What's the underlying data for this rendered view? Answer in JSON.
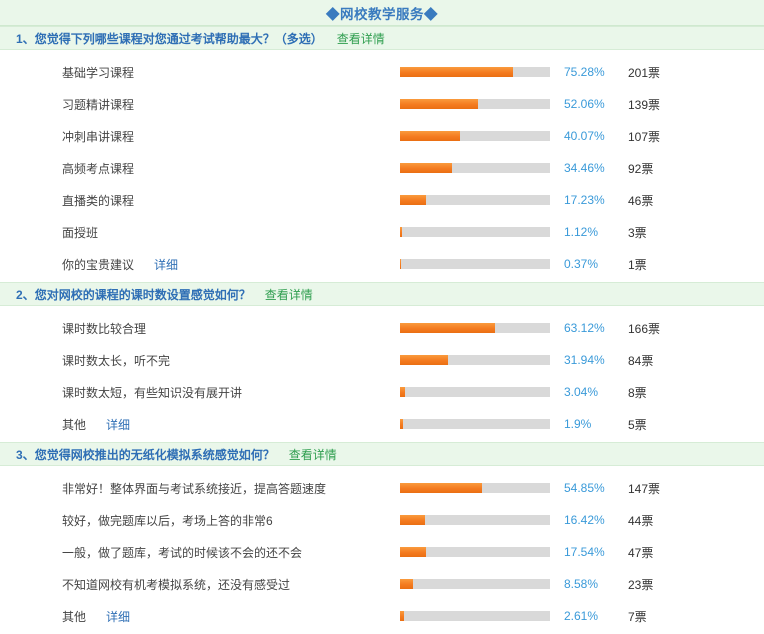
{
  "header": {
    "title": "◆网校教学服务◆",
    "accent_color": "#3a7bbf",
    "band_color": "#eaf7ea"
  },
  "labels": {
    "detail_link": "查看详情",
    "inline_detail": "详细",
    "vote_unit": "票"
  },
  "chart_data": [
    {
      "type": "bar",
      "orientation": "horizontal",
      "title": "1、您觉得下列哪些课程对您通过考试帮助最大？（多选）",
      "number": "1、",
      "question": "您觉得下列哪些课程对您通过考试帮助最大？（多选）",
      "link": "查看详情",
      "xlabel": "",
      "ylabel": "",
      "xlim": [
        0,
        100
      ],
      "unit": "%",
      "grid": false,
      "bar_color": "#f47b20",
      "track_color": "#d9d9d9",
      "categories": [
        "基础学习课程",
        "习题精讲课程",
        "冲刺串讲课程",
        "高频考点课程",
        "直播类的课程",
        "面授班",
        "你的宝贵建议"
      ],
      "values": [
        75.28,
        52.06,
        40.07,
        34.46,
        17.23,
        1.12,
        0.37
      ],
      "pct_labels": [
        "75.28%",
        "52.06%",
        "40.07%",
        "34.46%",
        "17.23%",
        "1.12%",
        "0.37%"
      ],
      "counts": [
        201,
        139,
        107,
        92,
        46,
        3,
        1
      ],
      "count_labels": [
        "201票",
        "139票",
        "107票",
        "92票",
        "46票",
        "3票",
        "1票"
      ],
      "extras": [
        null,
        null,
        null,
        null,
        null,
        null,
        "详细"
      ]
    },
    {
      "type": "bar",
      "orientation": "horizontal",
      "title": "2、您对网校的课程的课时数设置感觉如何？",
      "number": "2、",
      "question": "您对网校的课程的课时数设置感觉如何？",
      "link": "查看详情",
      "xlabel": "",
      "ylabel": "",
      "xlim": [
        0,
        100
      ],
      "unit": "%",
      "grid": false,
      "bar_color": "#f47b20",
      "track_color": "#d9d9d9",
      "categories": [
        "课时数比较合理",
        "课时数太长，听不完",
        "课时数太短，有些知识没有展开讲",
        "其他"
      ],
      "values": [
        63.12,
        31.94,
        3.04,
        1.9
      ],
      "pct_labels": [
        "63.12%",
        "31.94%",
        "3.04%",
        "1.9%"
      ],
      "counts": [
        166,
        84,
        8,
        5
      ],
      "count_labels": [
        "166票",
        "84票",
        "8票",
        "5票"
      ],
      "extras": [
        null,
        null,
        null,
        "详细"
      ]
    },
    {
      "type": "bar",
      "orientation": "horizontal",
      "title": "3、您觉得网校推出的无纸化模拟系统感觉如何？",
      "number": "3、",
      "question": "您觉得网校推出的无纸化模拟系统感觉如何？",
      "link": "查看详情",
      "xlabel": "",
      "ylabel": "",
      "xlim": [
        0,
        100
      ],
      "unit": "%",
      "grid": false,
      "bar_color": "#f47b20",
      "track_color": "#d9d9d9",
      "categories": [
        "非常好！整体界面与考试系统接近，提高答题速度",
        "较好，做完题库以后，考场上答的非常6",
        "一般，做了题库，考试的时候该不会的还不会",
        "不知道网校有机考模拟系统，还没有感受过",
        "其他"
      ],
      "values": [
        54.85,
        16.42,
        17.54,
        8.58,
        2.61
      ],
      "pct_labels": [
        "54.85%",
        "16.42%",
        "17.54%",
        "8.58%",
        "2.61%"
      ],
      "counts": [
        147,
        44,
        47,
        23,
        7
      ],
      "count_labels": [
        "147票",
        "44票",
        "47票",
        "23票",
        "7票"
      ],
      "extras": [
        null,
        null,
        null,
        null,
        "详细"
      ]
    }
  ]
}
